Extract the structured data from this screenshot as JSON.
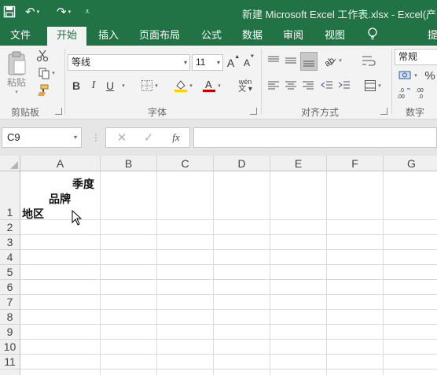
{
  "title": "新建 Microsoft Excel 工作表.xlsx - Excel(产品",
  "tabs": [
    "文件",
    "开始",
    "插入",
    "页面布局",
    "公式",
    "数据",
    "审阅",
    "视图",
    "提"
  ],
  "active_tab": "开始",
  "ribbon": {
    "clipboard": {
      "label": "剪贴板",
      "paste": "粘贴"
    },
    "font": {
      "label": "字体",
      "font_name": "等线",
      "font_size": "11",
      "bold": "B",
      "italic": "I",
      "underline": "U",
      "grow": "A",
      "shrink": "A",
      "phonetic": "wén"
    },
    "alignment": {
      "label": "对齐方式"
    },
    "number": {
      "label": "数字",
      "format": "常规",
      "percent": "%"
    }
  },
  "formula_bar": {
    "name_box": "C9",
    "fx": "fx",
    "formula": ""
  },
  "columns": [
    "A",
    "B",
    "C",
    "D",
    "E",
    "F",
    "G"
  ],
  "rows": [
    "1",
    "2",
    "3",
    "4",
    "5",
    "6",
    "7",
    "8",
    "9",
    "10",
    "11"
  ],
  "cell_a1": {
    "line1": "季度",
    "line2": "品牌",
    "line3": "地区"
  },
  "colors": {
    "accent": "#217346"
  }
}
